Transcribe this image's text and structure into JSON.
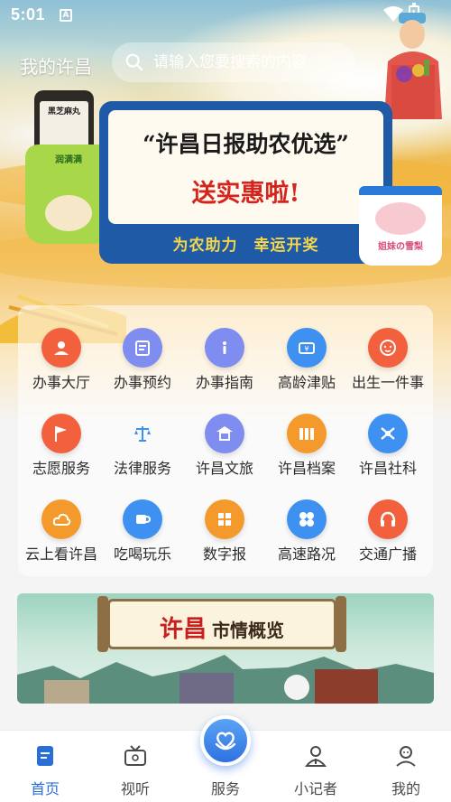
{
  "status_bar": {
    "time": "5:01",
    "app_icon_letter": "A",
    "battery_glyph": "!"
  },
  "header": {
    "title": "我的许昌"
  },
  "search": {
    "placeholder": "请输入您要搜索的内容",
    "value": ""
  },
  "banner": {
    "title": "“许昌日报助农优选”",
    "subtitle": "送实惠啦!",
    "strip": "为农助力　幸运开奖",
    "bottle_label": "黑芝麻丸",
    "bag_label": "润满满",
    "cup_label": "姐妹の雪梨"
  },
  "services": [
    {
      "label": "办事大厅",
      "icon": "person-icon",
      "color": "#f2603d"
    },
    {
      "label": "办事预约",
      "icon": "calendar-icon",
      "color": "#7f8cf0"
    },
    {
      "label": "办事指南",
      "icon": "info-icon",
      "color": "#7f8cf0"
    },
    {
      "label": "高龄津贴",
      "icon": "yen-ticket-icon",
      "color": "#3e91f0"
    },
    {
      "label": "出生一件事",
      "icon": "baby-face-icon",
      "color": "#f2603d"
    },
    {
      "label": "志愿服务",
      "icon": "flag-icon",
      "color": "#f2603d"
    },
    {
      "label": "法律服务",
      "icon": "scales-icon",
      "color": "#ffffff"
    },
    {
      "label": "许昌文旅",
      "icon": "pavilion-icon",
      "color": "#7f8cf0"
    },
    {
      "label": "许昌档案",
      "icon": "archive-icon",
      "color": "#f49a2c"
    },
    {
      "label": "许昌社科",
      "icon": "social-science-icon",
      "color": "#3e91f0"
    },
    {
      "label": "云上看许昌",
      "icon": "cloud-icon",
      "color": "#f49a2c"
    },
    {
      "label": "吃喝玩乐",
      "icon": "cup-icon",
      "color": "#3e91f0"
    },
    {
      "label": "数字报",
      "icon": "grid-icon",
      "color": "#f49a2c"
    },
    {
      "label": "高速路况",
      "icon": "clover-icon",
      "color": "#3e91f0"
    },
    {
      "label": "交通广播",
      "icon": "headphones-icon",
      "color": "#f2603d"
    }
  ],
  "market": {
    "title_a": "许昌",
    "title_b": "市情概览"
  },
  "bottom_nav": [
    {
      "label": "首页",
      "icon": "home-doc-icon",
      "active": true
    },
    {
      "label": "视听",
      "icon": "tv-icon",
      "active": false
    },
    {
      "label": "服务",
      "icon": "heart-hands-icon",
      "active": false
    },
    {
      "label": "小记者",
      "icon": "reporter-icon",
      "active": false
    },
    {
      "label": "我的",
      "icon": "profile-icon",
      "active": false
    }
  ],
  "colors": {
    "accent": "#2a6fd8",
    "nav_active": "#2a6fd8",
    "banner_board": "#1f5aa6",
    "banner_red": "#d4251c"
  }
}
